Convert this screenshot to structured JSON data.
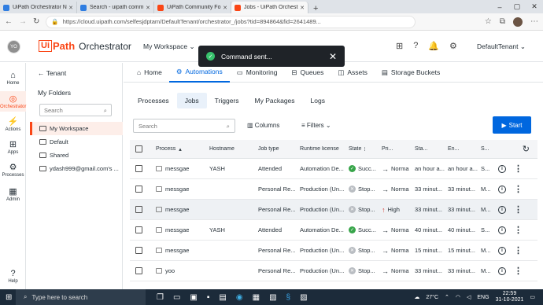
{
  "browser": {
    "tabs": [
      {
        "label": "UiPath Orchestrator New Design",
        "color": "#2f7de1"
      },
      {
        "label": "Search - uipath community",
        "color": "#2f7de1"
      },
      {
        "label": "UiPath Community Forum",
        "color": "#fa4616"
      },
      {
        "label": "Jobs - UiPath Orchestrator",
        "color": "#fa4616"
      }
    ],
    "url": "https://cloud.uipath.com/selfesjdptam/DefaultTenant/orchestrator_/jobs?tid=894864&fid=2641489..."
  },
  "header": {
    "avatar": "YO",
    "logo_ui": "Ui",
    "logo_path": "Path",
    "logo_product": "Orchestrator",
    "workspace": "My Workspace",
    "tenant": "DefaultTenant"
  },
  "toast": {
    "message": "Command sent..."
  },
  "rail": [
    {
      "label": "Home",
      "icon": "home-icon"
    },
    {
      "label": "Orchestrator",
      "icon": "orchestrator-icon"
    },
    {
      "label": "Actions",
      "icon": "actions-icon"
    },
    {
      "label": "Apps",
      "icon": "apps-icon"
    },
    {
      "label": "Processes",
      "icon": "processes-icon"
    },
    {
      "label": "Admin",
      "icon": "admin-icon"
    },
    {
      "label": "Help",
      "icon": "help-icon"
    }
  ],
  "folders": {
    "tenant": "Tenant",
    "my_folders": "My Folders",
    "search_placeholder": "Search",
    "items": [
      "My Workspace",
      "Default",
      "Shared",
      "ydash999@gmail.com's ..."
    ]
  },
  "nav": {
    "tabs": [
      "Home",
      "Automations",
      "Monitoring",
      "Queues",
      "Assets",
      "Storage Buckets"
    ]
  },
  "subtabs": [
    "Processes",
    "Jobs",
    "Triggers",
    "My Packages",
    "Logs"
  ],
  "toolbar": {
    "search_placeholder": "Search",
    "columns": "Columns",
    "filters": "Filters",
    "start": "Start"
  },
  "table": {
    "headers": [
      "Process",
      "Hostname",
      "Job type",
      "Runtime license",
      "State",
      "Pri...",
      "Sta...",
      "En...",
      "S..."
    ],
    "rows": [
      {
        "process": "messgae",
        "host": "YASH",
        "type": "Attended",
        "license": "Automation De...",
        "state": "Succ...",
        "state_kind": "ok",
        "pri_arrow": "→",
        "priority": "Norma",
        "start": "an hour a...",
        "end": "an hour a...",
        "s": "S..."
      },
      {
        "process": "messgae",
        "host": "",
        "type": "Personal Re...",
        "license": "Production (Un...",
        "state": "Stop...",
        "state_kind": "stop",
        "pri_arrow": "→",
        "priority": "Norma",
        "start": "33 minut...",
        "end": "33 minut...",
        "s": "M..."
      },
      {
        "process": "messgae",
        "host": "",
        "type": "Personal Re...",
        "license": "Production (Un...",
        "state": "Stop...",
        "state_kind": "stop",
        "pri_arrow": "↑",
        "priority": "High",
        "start": "33 minut...",
        "end": "33 minut...",
        "s": "M..."
      },
      {
        "process": "messgae",
        "host": "YASH",
        "type": "Attended",
        "license": "Automation De...",
        "state": "Succ...",
        "state_kind": "ok",
        "pri_arrow": "→",
        "priority": "Norma",
        "start": "40 minut...",
        "end": "40 minut...",
        "s": "S..."
      },
      {
        "process": "messgae",
        "host": "",
        "type": "Personal Re...",
        "license": "Production (Un...",
        "state": "Stop...",
        "state_kind": "stop",
        "pri_arrow": "→",
        "priority": "Norma",
        "start": "15 minut...",
        "end": "15 minut...",
        "s": "M..."
      },
      {
        "process": "yoo",
        "host": "",
        "type": "Personal Re...",
        "license": "Production (Un...",
        "state": "Stop...",
        "state_kind": "stop",
        "pri_arrow": "→",
        "priority": "Norma",
        "start": "33 minut...",
        "end": "33 minut...",
        "s": "M..."
      }
    ]
  },
  "taskbar": {
    "search": "Type here to search",
    "weather": "27°C",
    "lang": "ENG",
    "time": "22:59",
    "date": "31-10-2021"
  }
}
